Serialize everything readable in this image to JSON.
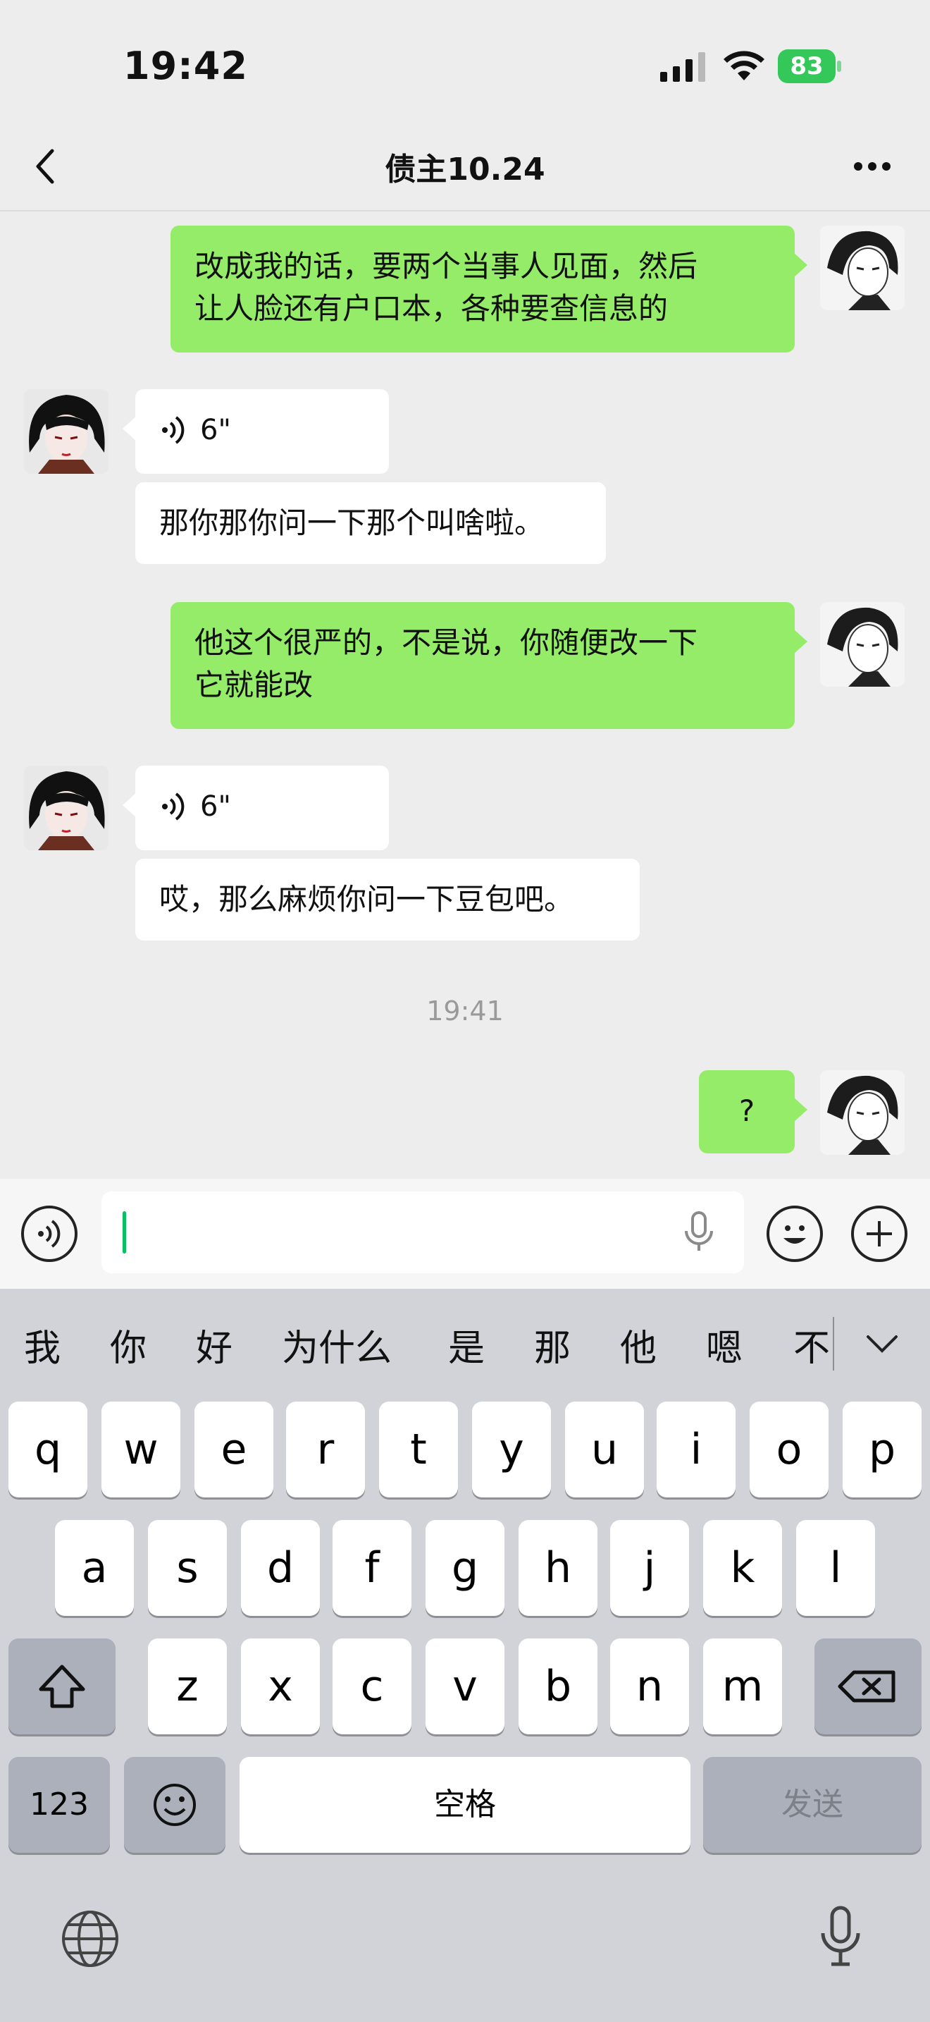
{
  "status": {
    "time": "19:42",
    "battery": "83"
  },
  "nav": {
    "title": "债主10.24"
  },
  "messages": [
    {
      "side": "right",
      "type": "text",
      "text_lines": [
        "改成我的话，要两个当事人见面，然后",
        "让人脸还有户口本，各种要查信息的"
      ]
    },
    {
      "side": "left",
      "type": "voice",
      "duration": "6\""
    },
    {
      "side": "left",
      "type": "text",
      "text": "那你那你问一下那个叫啥啦。"
    },
    {
      "side": "right",
      "type": "text",
      "text_lines": [
        "他这个很严的，不是说，你随便改一下",
        "它就能改"
      ]
    },
    {
      "side": "left",
      "type": "voice",
      "duration": "6\""
    },
    {
      "side": "left",
      "type": "text",
      "text": "哎，那么麻烦你问一下豆包吧。"
    },
    {
      "side": "right",
      "type": "text",
      "text": "?"
    }
  ],
  "timestamp": "19:41",
  "keyboard": {
    "candidates": [
      "我",
      "你",
      "好",
      "为什么",
      "是",
      "那",
      "他",
      "嗯",
      "不"
    ],
    "row1": [
      "q",
      "w",
      "e",
      "r",
      "t",
      "y",
      "u",
      "i",
      "o",
      "p"
    ],
    "row2": [
      "a",
      "s",
      "d",
      "f",
      "g",
      "h",
      "j",
      "k",
      "l"
    ],
    "row3": [
      "z",
      "x",
      "c",
      "v",
      "b",
      "n",
      "m"
    ],
    "numbers_key": "123",
    "space_key": "空格",
    "send_key": "发送"
  },
  "colors": {
    "sent_bubble": "#95ec69",
    "received_bubble": "#ffffff",
    "accent": "#07c160"
  }
}
